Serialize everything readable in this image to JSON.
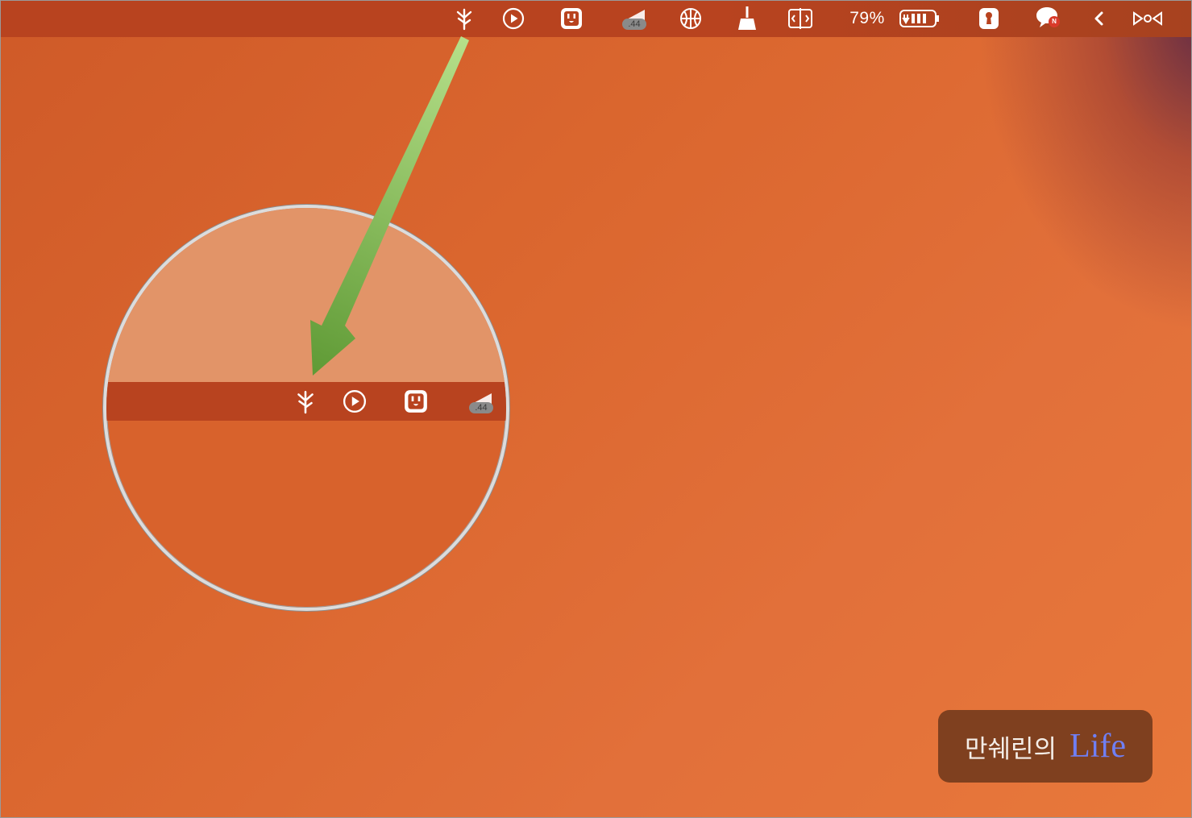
{
  "colors": {
    "menubar": "#b8431f",
    "desktop": "#db672f",
    "arrow": "#8cc34f",
    "watermark_bg": "#7f401f",
    "watermark_accent": "#6f7ff4"
  },
  "menubar": {
    "icons": [
      "plant-icon",
      "play-icon",
      "outlet-icon",
      "volume-meter-icon",
      "basketball-icon",
      "broom-icon",
      "split-screen-icon",
      "battery-icon",
      "keyhole-icon",
      "chat-icon",
      "chevron-left-icon",
      "infinity-icon"
    ],
    "volume_badge": ".44",
    "battery_percent": "79%",
    "chat_badge": "N"
  },
  "magnifier": {
    "volume_badge": ".44"
  },
  "watermark": {
    "korean": "만쉐린의",
    "latin": "Life"
  }
}
